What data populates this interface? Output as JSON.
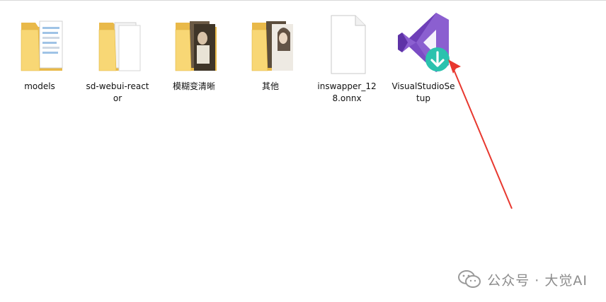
{
  "items": [
    {
      "label": "models",
      "icon": "folder-with-documents-icon"
    },
    {
      "label": "sd-webui-reactor",
      "icon": "folder-with-white-pages-icon"
    },
    {
      "label": "模糊变清晰",
      "icon": "folder-with-photos-icon"
    },
    {
      "label": "其他",
      "icon": "folder-with-photos-icon"
    },
    {
      "label": "inswapper_128.onnx",
      "icon": "blank-file-icon"
    },
    {
      "label": "VisualStudioSetup",
      "icon": "visual-studio-installer-icon"
    }
  ],
  "watermark": {
    "text": "公众号 · 大觉AI",
    "icon": "wechat-icon"
  },
  "colors": {
    "folder": "#F8D775",
    "folder_dark": "#E9B949",
    "vs_purple": "#8B5FD0",
    "vs_download_badge": "#2BC2AE",
    "annotation_arrow": "#E8382F"
  }
}
